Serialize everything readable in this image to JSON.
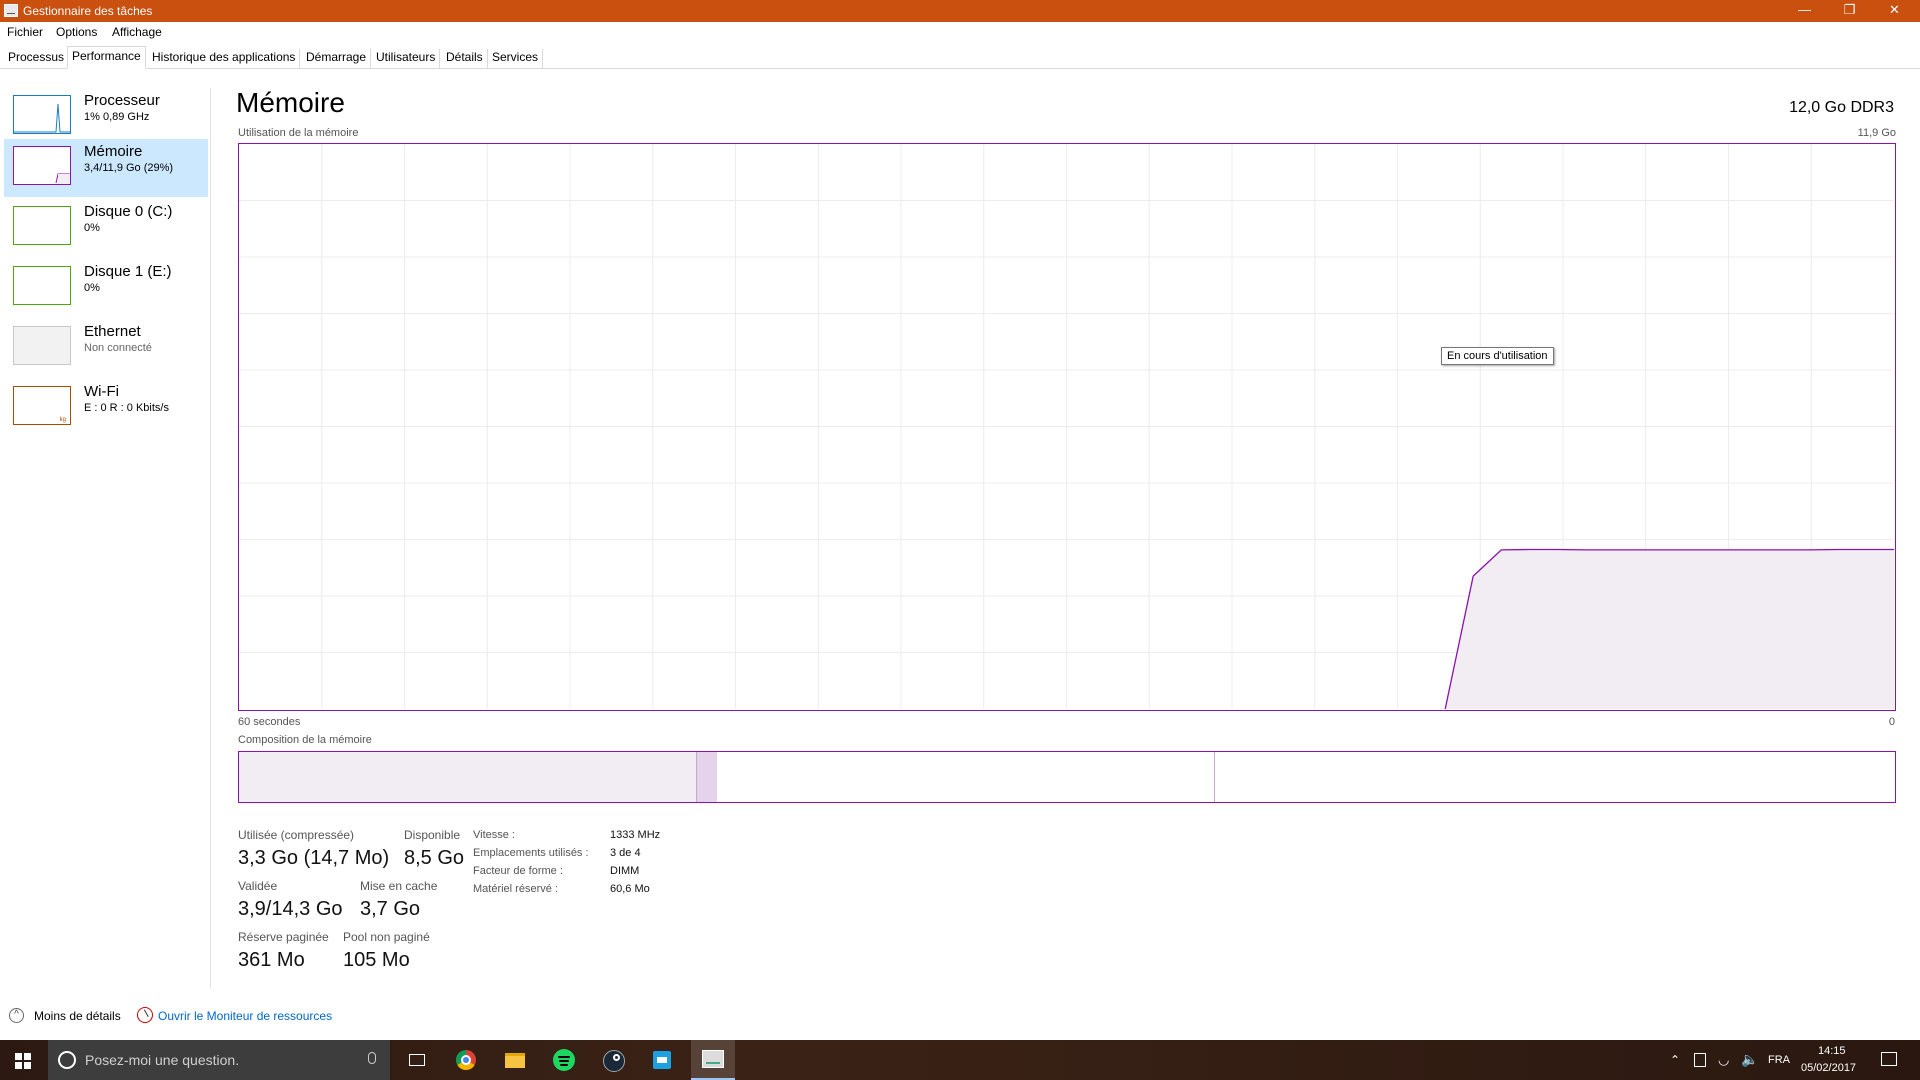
{
  "window": {
    "title": "Gestionnaire des tâches",
    "min": "—",
    "max": "❐",
    "close": "✕"
  },
  "menu": [
    "Fichier",
    "Options",
    "Affichage"
  ],
  "tabs": [
    "Processus",
    "Performance",
    "Historique des applications",
    "Démarrage",
    "Utilisateurs",
    "Détails",
    "Services"
  ],
  "active_tab": "Performance",
  "sidebar": [
    {
      "title": "Processeur",
      "sub": "1% 0,89 GHz",
      "color": "#1a7dc4",
      "selected": false
    },
    {
      "title": "Mémoire",
      "sub": "3,4/11,9 Go (29%)",
      "color": "#8b12ae",
      "selected": true
    },
    {
      "title": "Disque 0 (C:)",
      "sub": "0%",
      "color": "#4da60c",
      "selected": false
    },
    {
      "title": "Disque 1 (E:)",
      "sub": "0%",
      "color": "#4da60c",
      "selected": false
    },
    {
      "title": "Ethernet",
      "sub": "Non connecté",
      "color": "#c8c8c8",
      "selected": false
    },
    {
      "title": "Wi-Fi",
      "sub": "E : 0 R : 0 Kbits/s",
      "color": "#a74f01",
      "selected": false,
      "thumb_label": "kg"
    }
  ],
  "main": {
    "title": "Mémoire",
    "spec": "12,0 Go DDR3",
    "usage_label": "Utilisation de la mémoire",
    "usage_max": "11,9 Go",
    "time_left": "60 secondes",
    "time_right": "0",
    "composition_label": "Composition de la mémoire",
    "tooltip": "En cours d'utilisation"
  },
  "chart_data": {
    "type": "area",
    "series": [
      {
        "values": [
          0,
          0,
          0,
          0,
          0,
          0,
          0,
          0,
          0,
          0,
          0,
          0,
          0,
          0,
          0,
          0,
          0,
          0,
          0,
          0,
          0,
          0,
          0,
          0,
          0,
          0,
          0,
          0,
          0,
          0,
          0,
          0,
          0,
          0,
          0,
          0,
          0,
          0,
          0,
          0,
          0,
          0,
          0,
          0,
          2.8,
          3.35,
          3.36,
          3.36,
          3.35,
          3.35,
          3.35,
          3.35,
          3.35,
          3.35,
          3.35,
          3.35,
          3.35,
          3.36,
          3.36,
          3.36
        ]
      }
    ],
    "ylim": [
      0,
      11.9
    ],
    "color": "#8b12ae",
    "fill": "#f1edf3",
    "grid": true
  },
  "composition": {
    "in_use_fraction": 0.276,
    "modified_fraction": 0.013,
    "standby_fraction": 0.3
  },
  "stats": {
    "used_label": "Utilisée (compressée)",
    "used_value": "3,3 Go (14,7 Mo)",
    "avail_label": "Disponible",
    "avail_value": "8,5 Go",
    "committed_label": "Validée",
    "committed_value": "3,9/14,3 Go",
    "cached_label": "Mise en cache",
    "cached_value": "3,7 Go",
    "paged_label": "Réserve paginée",
    "paged_value": "361 Mo",
    "nonpaged_label": "Pool non paginé",
    "nonpaged_value": "105 Mo"
  },
  "details": [
    {
      "label": "Vitesse :",
      "value": "1333 MHz"
    },
    {
      "label": "Emplacements utilisés :",
      "value": "3 de 4"
    },
    {
      "label": "Facteur de forme :",
      "value": "DIMM"
    },
    {
      "label": "Matériel réservé :",
      "value": "60,6 Mo"
    }
  ],
  "footer": {
    "fewer": "Moins de détails",
    "monitor": "Ouvrir le Moniteur de ressources",
    "chevron": "^"
  },
  "taskbar": {
    "search_placeholder": "Posez-moi une question.",
    "lang": "FRA",
    "time": "14:15",
    "date": "05/02/2017"
  }
}
